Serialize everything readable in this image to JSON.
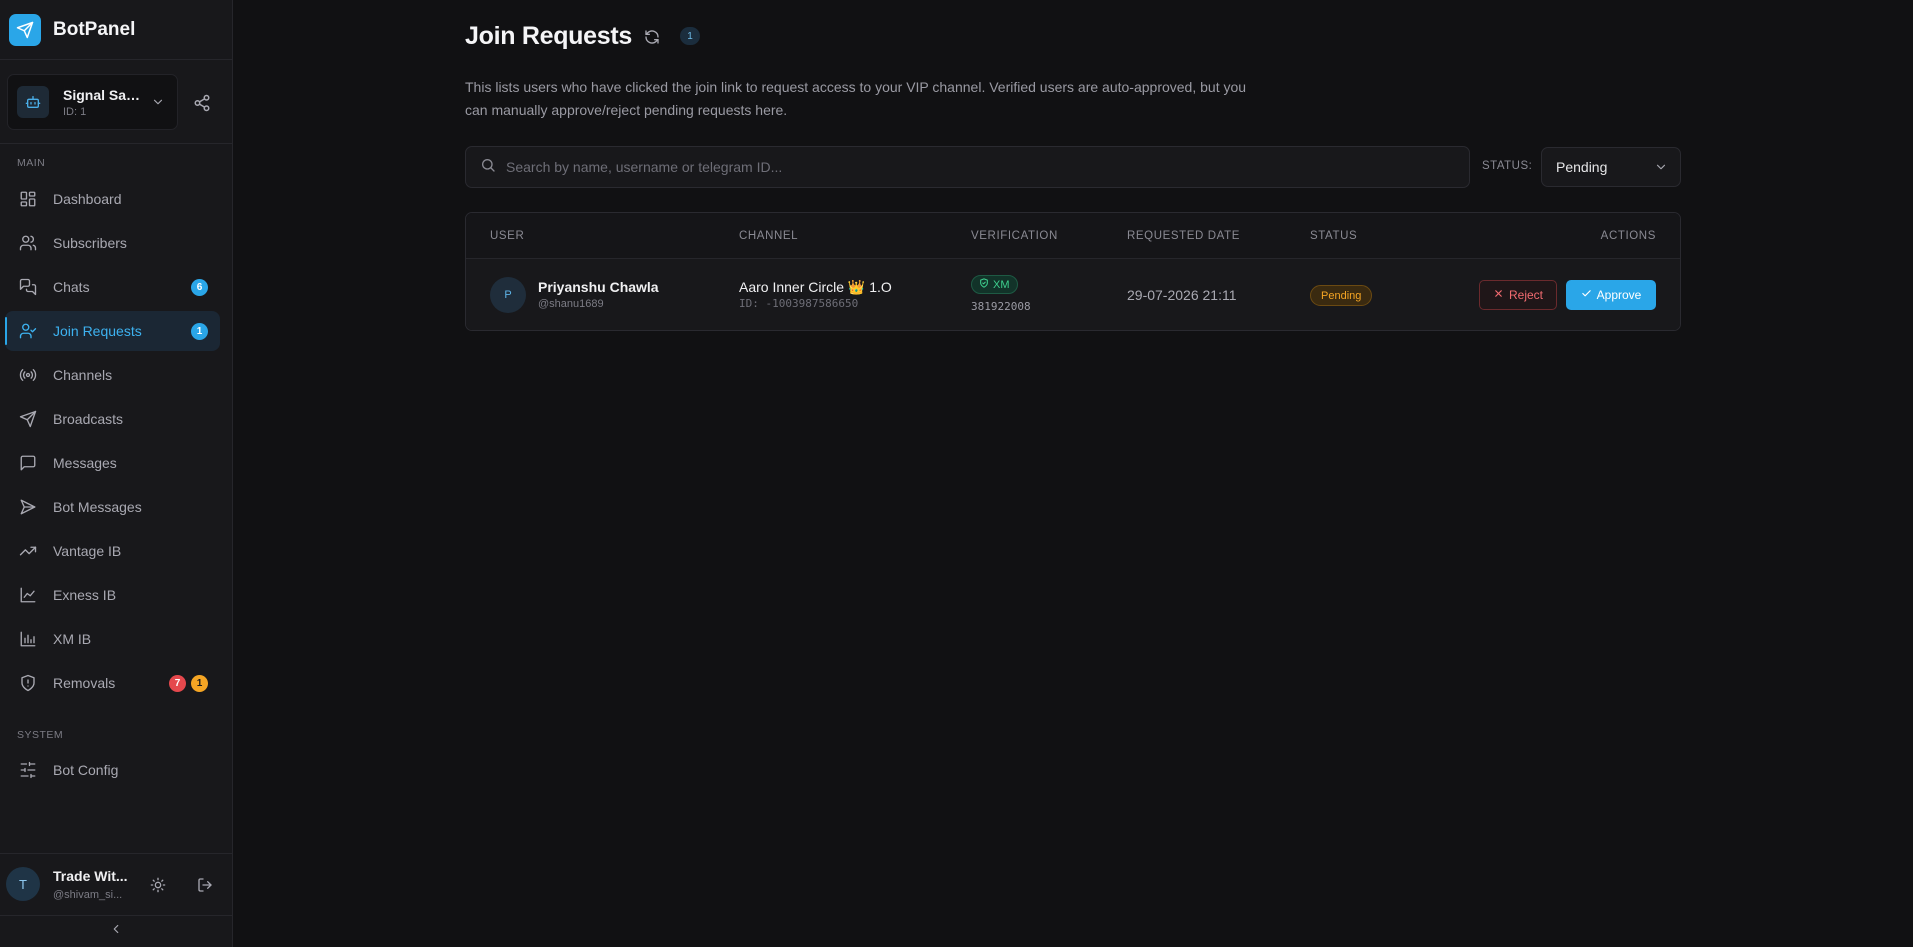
{
  "brand": {
    "name": "BotPanel"
  },
  "bot_selector": {
    "name": "Signal Saa...",
    "id_label": "ID: 1"
  },
  "sidebar": {
    "sections": {
      "main": "MAIN",
      "system": "SYSTEM"
    },
    "items": [
      {
        "label": "Dashboard",
        "icon": "grid-icon"
      },
      {
        "label": "Subscribers",
        "icon": "users-icon"
      },
      {
        "label": "Chats",
        "icon": "chat-bubbles-icon",
        "badges": [
          "6"
        ]
      },
      {
        "label": "Join Requests",
        "icon": "user-check-icon",
        "badges": [
          "1"
        ],
        "active": true
      },
      {
        "label": "Channels",
        "icon": "radio-icon"
      },
      {
        "label": "Broadcasts",
        "icon": "send-icon"
      },
      {
        "label": "Messages",
        "icon": "message-square-icon"
      },
      {
        "label": "Bot Messages",
        "icon": "send-arrow-icon"
      },
      {
        "label": "Vantage IB",
        "icon": "trending-up-icon"
      },
      {
        "label": "Exness IB",
        "icon": "line-chart-icon"
      },
      {
        "label": "XM IB",
        "icon": "bar-chart-icon"
      },
      {
        "label": "Removals",
        "icon": "shield-alert-icon",
        "badges": [
          "7",
          "1"
        ]
      }
    ],
    "system_items": [
      {
        "label": "Bot Config",
        "icon": "sliders-icon"
      }
    ]
  },
  "user": {
    "initial": "T",
    "name": "Trade Wit...",
    "handle": "@shivam_si..."
  },
  "page": {
    "title": "Join Requests",
    "count": "1",
    "description": "This lists users who have clicked the join link to request access to your VIP channel. Verified users are auto-approved, but you can manually approve/reject pending requests here."
  },
  "search": {
    "placeholder": "Search by name, username or telegram ID...",
    "value": ""
  },
  "status_filter": {
    "label": "STATUS:",
    "selected": "Pending"
  },
  "table": {
    "columns": [
      "USER",
      "CHANNEL",
      "VERIFICATION",
      "REQUESTED DATE",
      "STATUS",
      "ACTIONS"
    ],
    "rows": [
      {
        "initial": "P",
        "name": "Priyanshu Chawla",
        "handle": "@shanu1689",
        "channel": "Aaro Inner Circle 👑 1.O",
        "channel_id": "ID: -1003987586650",
        "verification_badge": "XM",
        "verification_id": "381922008",
        "requested_date": "29-07-2026 21:11",
        "status": "Pending",
        "reject_label": "Reject",
        "approve_label": "Approve"
      }
    ]
  },
  "colors": {
    "accent": "#2aa6e8",
    "background": "#111113",
    "sidebar": "#18181b",
    "pending": "#f5a524",
    "reject": "#f26b70",
    "verified": "#3ecf8e"
  }
}
